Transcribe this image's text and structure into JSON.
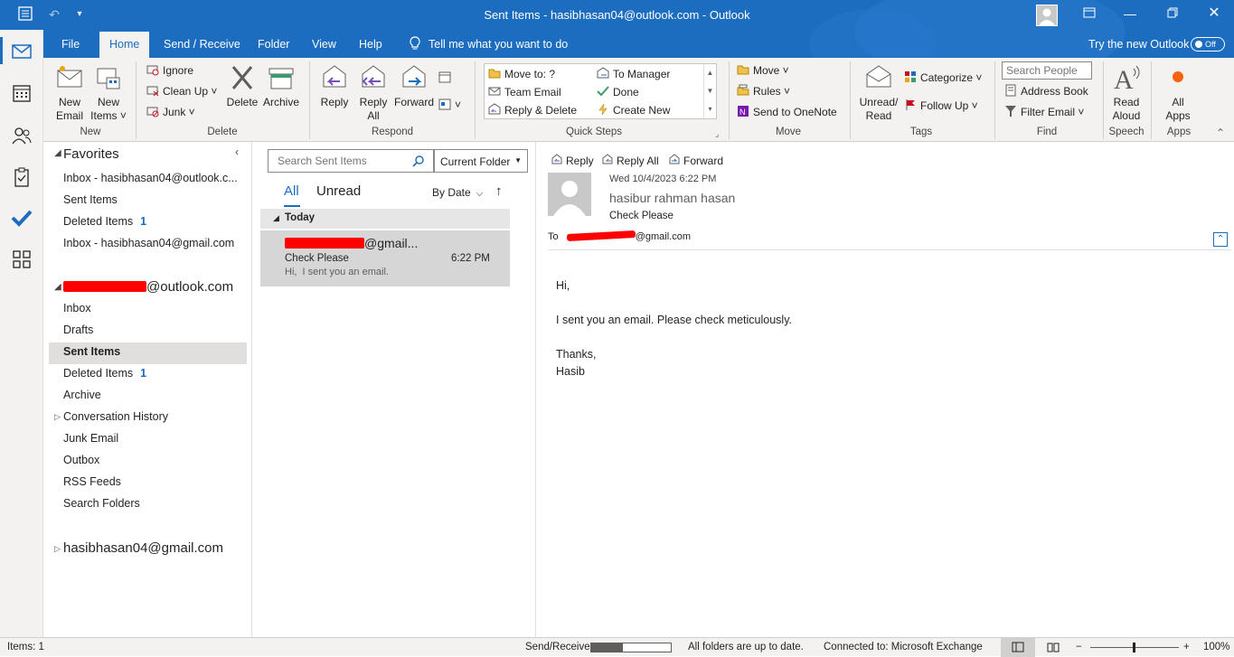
{
  "window": {
    "title": "Sent Items - hasibhasan04@outlook.com - Outlook"
  },
  "tabs": [
    {
      "label": "File"
    },
    {
      "label": "Home"
    },
    {
      "label": "Send / Receive"
    },
    {
      "label": "Folder"
    },
    {
      "label": "View"
    },
    {
      "label": "Help"
    }
  ],
  "tell_me": "Tell me what you want to do",
  "try_new": {
    "label": "Try the new Outlook",
    "toggle": "Off"
  },
  "ribbon": {
    "new": {
      "label": "New",
      "new_email": "New\nEmail",
      "new_items": "New\nItems ˅"
    },
    "delete": {
      "label": "Delete",
      "ignore": "Ignore",
      "clean_up": "Clean Up ˅",
      "junk": "Junk ˅",
      "delete": "Delete",
      "archive": "Archive"
    },
    "respond": {
      "label": "Respond",
      "reply": "Reply",
      "reply_all": "Reply\nAll",
      "forward": "Forward"
    },
    "quick_steps": {
      "label": "Quick Steps",
      "items": [
        "Move to: ?",
        "To Manager",
        "Team Email",
        "Done",
        "Reply & Delete",
        "Create New"
      ]
    },
    "move": {
      "label": "Move",
      "move": "Move ˅",
      "rules": "Rules ˅",
      "onenote": "Send to OneNote"
    },
    "tags": {
      "label": "Tags",
      "unread_read": "Unread/\nRead",
      "categorize": "Categorize ˅",
      "follow_up": "Follow Up ˅"
    },
    "find": {
      "label": "Find",
      "search_people": "Search People",
      "address_book": "Address Book",
      "filter_email": "Filter Email ˅"
    },
    "speech": {
      "label": "Speech",
      "read_aloud": "Read\nAloud"
    },
    "apps": {
      "label": "Apps",
      "all_apps": "All\nApps"
    }
  },
  "folders": {
    "favorites_header": "Favorites",
    "favorites": [
      {
        "name": "Inbox - hasibhasan04@outlook.c...",
        "count": ""
      },
      {
        "name": "Sent Items",
        "count": ""
      },
      {
        "name": "Deleted Items",
        "count": "1"
      },
      {
        "name": "Inbox - hasibhasan04@gmail.com",
        "count": ""
      }
    ],
    "account1_suffix": "@outlook.com",
    "account1": [
      {
        "name": "Inbox",
        "count": ""
      },
      {
        "name": "Drafts",
        "count": ""
      },
      {
        "name": "Sent Items",
        "count": ""
      },
      {
        "name": "Deleted Items",
        "count": "1"
      },
      {
        "name": "Archive",
        "count": ""
      },
      {
        "name": "Conversation History",
        "count": ""
      },
      {
        "name": "Junk Email",
        "count": ""
      },
      {
        "name": "Outbox",
        "count": ""
      },
      {
        "name": "RSS Feeds",
        "count": ""
      },
      {
        "name": "Search Folders",
        "count": ""
      }
    ],
    "account2": "hasibhasan04@gmail.com"
  },
  "message_list": {
    "search_placeholder": "Search Sent Items",
    "scope": "Current Folder",
    "filter_all": "All",
    "filter_unread": "Unread",
    "sort": "By Date",
    "group": "Today",
    "items": [
      {
        "to_suffix": "@gmail...",
        "subject": "Check Please",
        "time": "6:22 PM",
        "preview": "Hi,  I sent you an email."
      }
    ]
  },
  "reading": {
    "reply": "Reply",
    "reply_all": "Reply All",
    "forward": "Forward",
    "date": "Wed 10/4/2023 6:22 PM",
    "sender": "hasibur rahman hasan",
    "subject": "Check Please",
    "to_label": "To",
    "to_suffix": "@gmail.com",
    "body": [
      "Hi,",
      "I sent you an email. Please check meticulously.",
      "Thanks,",
      "Hasib"
    ]
  },
  "status": {
    "items": "Items: 1",
    "send_receive": "Send/Receive",
    "uptodate": "All folders are up to date.",
    "connected": "Connected to: Microsoft Exchange",
    "zoom": "100%"
  },
  "colors": {
    "brand": "#1c6cbf",
    "redaction": "#ff0000"
  }
}
